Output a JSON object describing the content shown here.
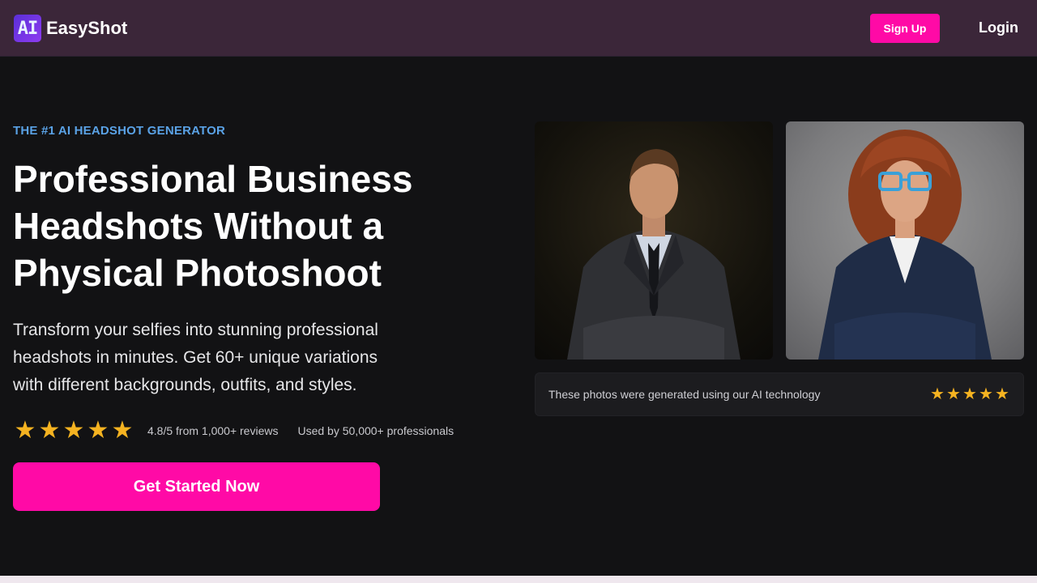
{
  "header": {
    "logo_badge": "AI",
    "logo_text": "EasyShot",
    "signup_label": "Sign Up",
    "login_label": "Login"
  },
  "hero": {
    "eyebrow": "THE #1 AI HEADSHOT GENERATOR",
    "headline_lines": [
      "Professional Business",
      "Headshots Without a",
      "Physical Photoshoot"
    ],
    "subtext": "Transform your selfies into stunning professional headshots in minutes. Get 60+ unique variations with different backgrounds, outfits, and styles.",
    "rating": {
      "value": 4.8,
      "max": 5,
      "stars_shown": 5,
      "text": "4.8/5 from 1,000+ reviews"
    },
    "used_by": "Used by 50,000+ professionals",
    "cta_label": "Get Started Now"
  },
  "showcase": {
    "caption": "These photos were generated using our AI technology",
    "stars_shown": 5
  },
  "colors": {
    "header_bg": "#3b2639",
    "page_bg": "#121214",
    "accent_pink": "#ff0aa6",
    "eyebrow_blue": "#5aa2e6",
    "star_gold": "#f5b321"
  },
  "icons": {
    "star": "star-icon",
    "logo": "ai-logo-icon"
  }
}
